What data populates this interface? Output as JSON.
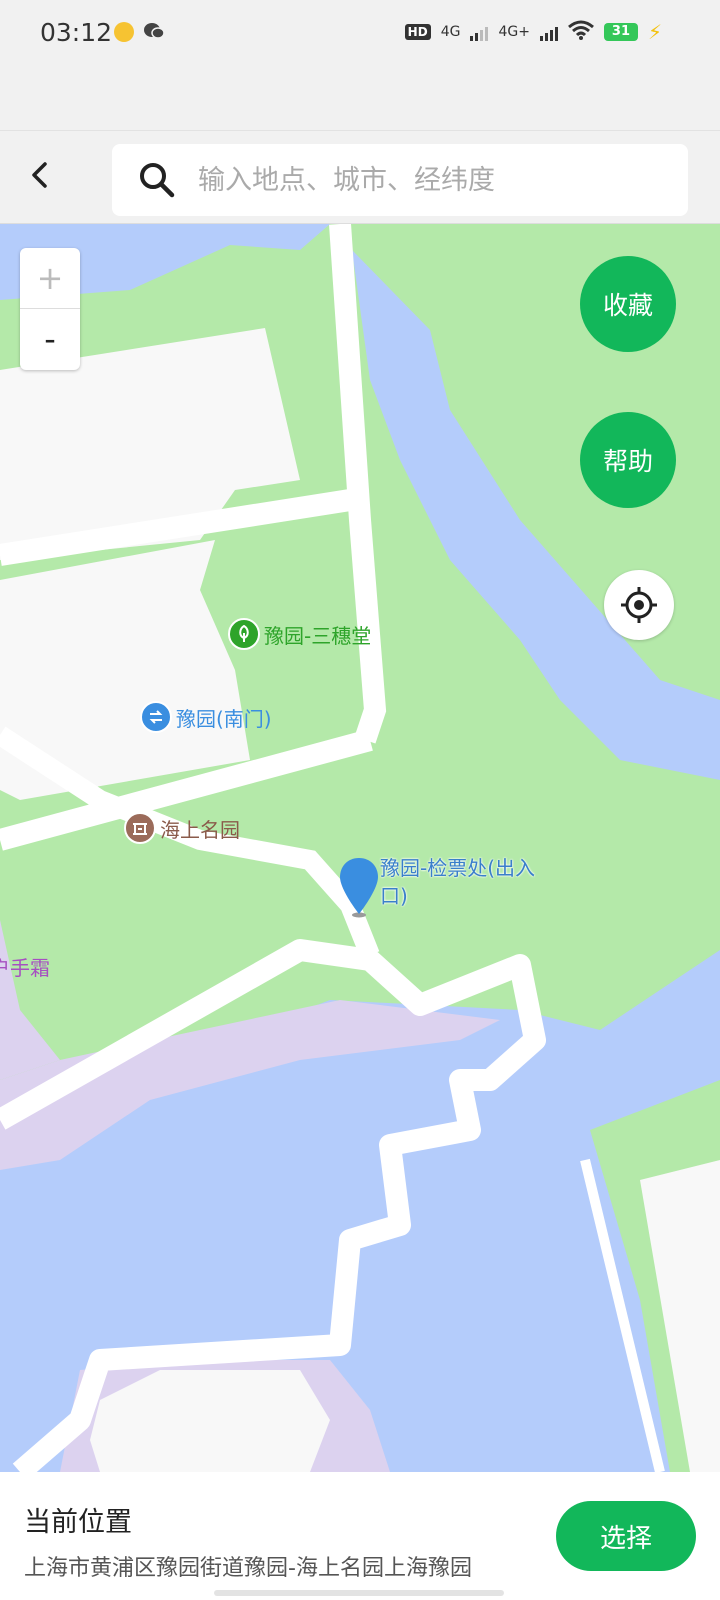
{
  "status_bar": {
    "time": "03:12",
    "hd": "HD",
    "net1": "4G",
    "net2": "4G+",
    "battery": "31"
  },
  "header": {
    "back_icon": "chevron-left-icon",
    "search": {
      "placeholder": "输入地点、城市、经纬度",
      "value": ""
    }
  },
  "map": {
    "zoom_in": "+",
    "zoom_out": "-",
    "favorite_label": "收藏",
    "help_label": "帮助",
    "locate_icon": "crosshair-icon",
    "pois": [
      {
        "name": "豫园-三穗堂",
        "icon": "tree-icon",
        "color": "#2ea42a"
      },
      {
        "name": "豫园(南门)",
        "icon": "gate-icon",
        "color": "#3a8ee0"
      },
      {
        "name": "海上名园",
        "icon": "landmark-icon",
        "color": "#9b6b5a"
      },
      {
        "name": "户手霜",
        "icon": "",
        "color": "#a64fc1"
      }
    ],
    "selected_pin": {
      "label": "豫园-检票处(出入口)",
      "icon": "map-pin-icon",
      "color": "#3a8ee0"
    }
  },
  "bottom": {
    "title": "当前位置",
    "address": "上海市黄浦区豫园街道豫园-海上名园上海豫园",
    "select_label": "选择"
  },
  "colors": {
    "accent": "#12b75a",
    "water": "#b4ccfb",
    "park": "#b4e9a9",
    "building": "#f8f8f8",
    "district": "#dcd2ef"
  }
}
